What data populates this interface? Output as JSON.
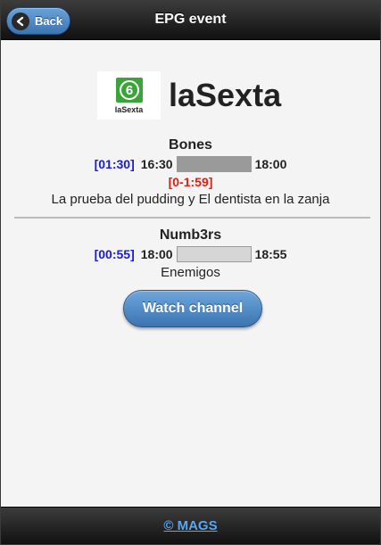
{
  "header": {
    "title": "EPG event",
    "back_label": "Back"
  },
  "channel": {
    "name": "laSexta",
    "logo_text": "laSexta",
    "logo_mark": "6"
  },
  "programs": [
    {
      "title": "Bones",
      "elapsed": "[01:30]",
      "start": "16:30",
      "end": "18:00",
      "progress": 1.0,
      "remaining": "[0-1:59]",
      "description": "La prueba del pudding y El dentista en la zanja"
    },
    {
      "title": "Numb3rs",
      "elapsed": "[00:55]",
      "start": "18:00",
      "end": "18:55",
      "progress": 0.0,
      "description": "Enemigos"
    }
  ],
  "actions": {
    "watch_label": "Watch channel"
  },
  "footer": {
    "copyright": "© MAGS"
  },
  "colors": {
    "accent": "#3b74b0",
    "elapsed": "#1a1adb",
    "remaining": "#e02010",
    "logo_green": "#3aa33a"
  }
}
